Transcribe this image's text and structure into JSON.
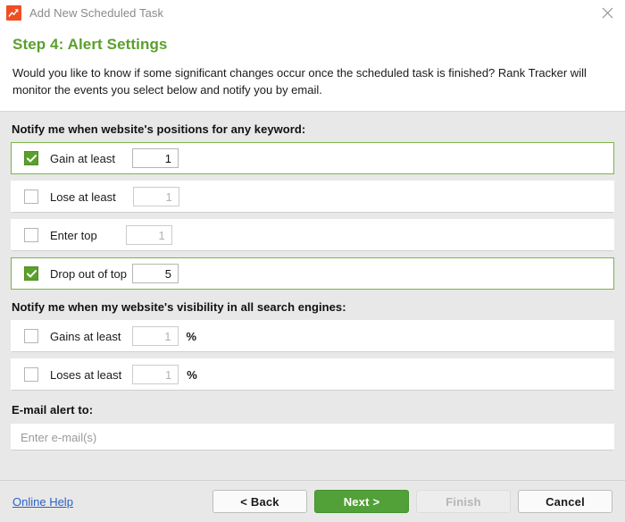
{
  "titlebar": {
    "app_icon": "rank-tracker-icon",
    "title": "Add New Scheduled Task",
    "close_icon": "close-icon"
  },
  "header": {
    "step_title": "Step 4: Alert Settings",
    "description": "Would you like to know if some significant changes occur once the scheduled task is finished? Rank Tracker will monitor the events you select below and notify you by email."
  },
  "sections": {
    "positions": {
      "label": "Notify me when website's positions for any keyword:",
      "rows": [
        {
          "label": "Gain at least",
          "checked": true,
          "value": "1",
          "suffix": ""
        },
        {
          "label": "Lose at least",
          "checked": false,
          "value": "1",
          "suffix": ""
        },
        {
          "label": "Enter top",
          "checked": false,
          "value": "1",
          "suffix": ""
        },
        {
          "label": "Drop out of top",
          "checked": true,
          "value": "5",
          "suffix": ""
        }
      ]
    },
    "visibility": {
      "label": "Notify me when my website's visibility in all search engines:",
      "rows": [
        {
          "label": "Gains at least",
          "checked": false,
          "value": "1",
          "suffix": "%"
        },
        {
          "label": "Loses at least",
          "checked": false,
          "value": "1",
          "suffix": "%"
        }
      ]
    },
    "email": {
      "label": "E-mail alert to:",
      "placeholder": "Enter e-mail(s)",
      "value": ""
    }
  },
  "footer": {
    "help_link": "Online Help",
    "back_button": "< Back",
    "next_button": "Next >",
    "finish_button": "Finish",
    "cancel_button": "Cancel"
  },
  "colors": {
    "accent_green": "#5aa02c",
    "primary_button": "#52a038",
    "link_blue": "#2b62c6",
    "app_icon_orange": "#f04e23",
    "body_background": "#e8e8e8"
  }
}
